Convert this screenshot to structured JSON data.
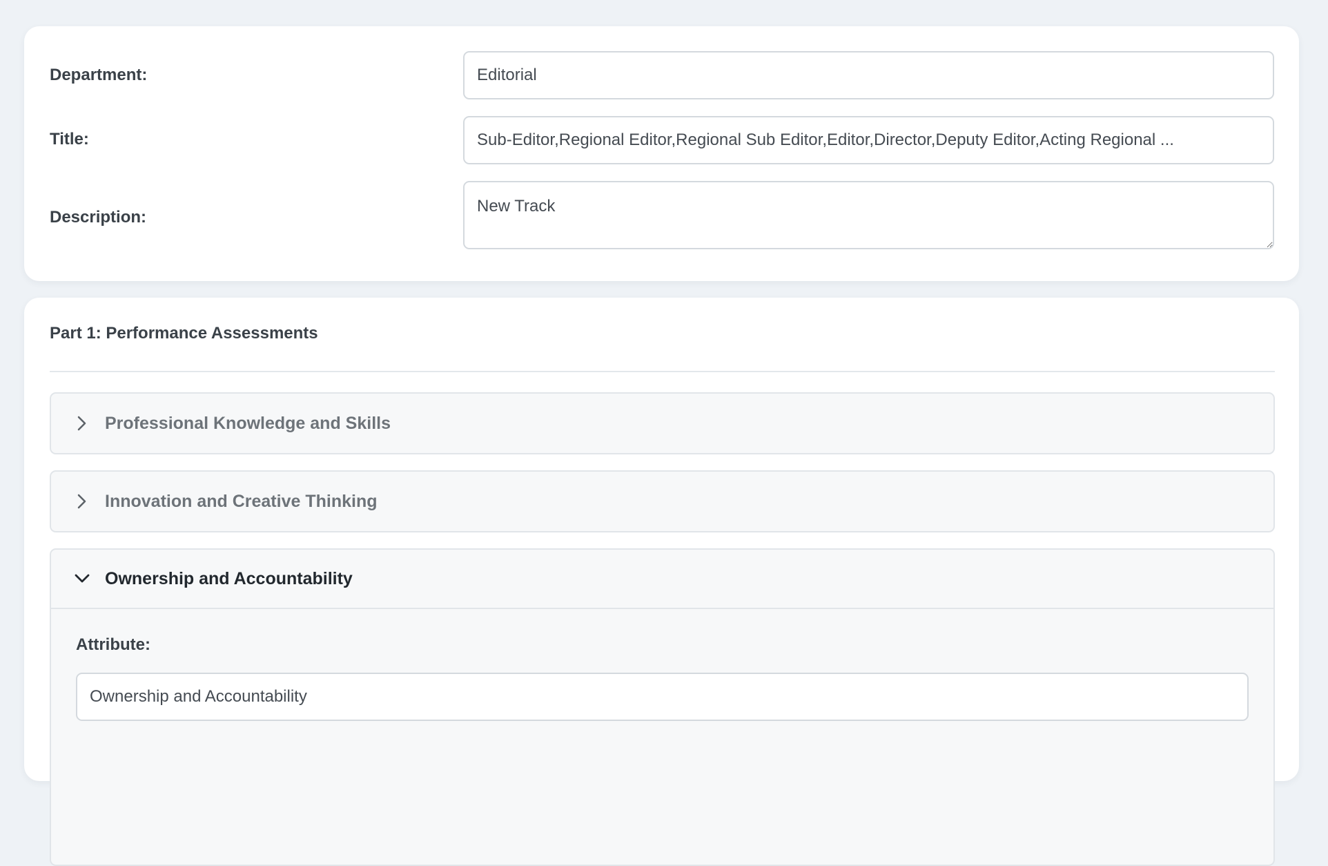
{
  "form": {
    "department_label": "Department:",
    "department_value": "Editorial",
    "title_label": "Title:",
    "title_value": "Sub-Editor,Regional Editor,Regional Sub Editor,Editor,Director,Deputy Editor,Acting Regional ...",
    "description_label": "Description:",
    "description_value": "New Track"
  },
  "part1": {
    "heading": "Part 1: Performance Assessments",
    "accordion": [
      {
        "title": "Professional Knowledge and Skills",
        "expanded": false,
        "icon": "chevron-right-icon"
      },
      {
        "title": "Innovation and Creative Thinking",
        "expanded": false,
        "icon": "chevron-right-icon"
      },
      {
        "title": "Ownership and Accountability",
        "expanded": true,
        "icon": "chevron-down-icon"
      }
    ],
    "expanded_body": {
      "attribute_label": "Attribute:",
      "attribute_value": "Ownership and Accountability"
    }
  },
  "colors": {
    "background": "#eef2f6",
    "card": "#ffffff",
    "accordion_bg": "#f7f8f9",
    "border": "#d4d9de",
    "muted_text": "#6d7379",
    "strong_text": "#22282e"
  }
}
